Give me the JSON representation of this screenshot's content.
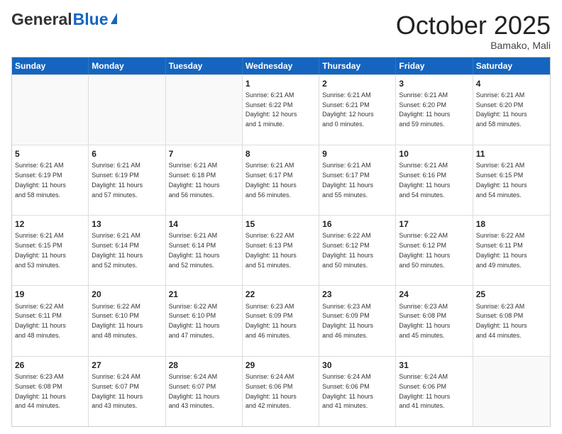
{
  "header": {
    "logo_general": "General",
    "logo_blue": "Blue",
    "month_title": "October 2025",
    "location": "Bamako, Mali"
  },
  "days_of_week": [
    "Sunday",
    "Monday",
    "Tuesday",
    "Wednesday",
    "Thursday",
    "Friday",
    "Saturday"
  ],
  "weeks": [
    [
      {
        "day": "",
        "info": ""
      },
      {
        "day": "",
        "info": ""
      },
      {
        "day": "",
        "info": ""
      },
      {
        "day": "1",
        "info": "Sunrise: 6:21 AM\nSunset: 6:22 PM\nDaylight: 12 hours\nand 1 minute."
      },
      {
        "day": "2",
        "info": "Sunrise: 6:21 AM\nSunset: 6:21 PM\nDaylight: 12 hours\nand 0 minutes."
      },
      {
        "day": "3",
        "info": "Sunrise: 6:21 AM\nSunset: 6:20 PM\nDaylight: 11 hours\nand 59 minutes."
      },
      {
        "day": "4",
        "info": "Sunrise: 6:21 AM\nSunset: 6:20 PM\nDaylight: 11 hours\nand 58 minutes."
      }
    ],
    [
      {
        "day": "5",
        "info": "Sunrise: 6:21 AM\nSunset: 6:19 PM\nDaylight: 11 hours\nand 58 minutes."
      },
      {
        "day": "6",
        "info": "Sunrise: 6:21 AM\nSunset: 6:19 PM\nDaylight: 11 hours\nand 57 minutes."
      },
      {
        "day": "7",
        "info": "Sunrise: 6:21 AM\nSunset: 6:18 PM\nDaylight: 11 hours\nand 56 minutes."
      },
      {
        "day": "8",
        "info": "Sunrise: 6:21 AM\nSunset: 6:17 PM\nDaylight: 11 hours\nand 56 minutes."
      },
      {
        "day": "9",
        "info": "Sunrise: 6:21 AM\nSunset: 6:17 PM\nDaylight: 11 hours\nand 55 minutes."
      },
      {
        "day": "10",
        "info": "Sunrise: 6:21 AM\nSunset: 6:16 PM\nDaylight: 11 hours\nand 54 minutes."
      },
      {
        "day": "11",
        "info": "Sunrise: 6:21 AM\nSunset: 6:15 PM\nDaylight: 11 hours\nand 54 minutes."
      }
    ],
    [
      {
        "day": "12",
        "info": "Sunrise: 6:21 AM\nSunset: 6:15 PM\nDaylight: 11 hours\nand 53 minutes."
      },
      {
        "day": "13",
        "info": "Sunrise: 6:21 AM\nSunset: 6:14 PM\nDaylight: 11 hours\nand 52 minutes."
      },
      {
        "day": "14",
        "info": "Sunrise: 6:21 AM\nSunset: 6:14 PM\nDaylight: 11 hours\nand 52 minutes."
      },
      {
        "day": "15",
        "info": "Sunrise: 6:22 AM\nSunset: 6:13 PM\nDaylight: 11 hours\nand 51 minutes."
      },
      {
        "day": "16",
        "info": "Sunrise: 6:22 AM\nSunset: 6:12 PM\nDaylight: 11 hours\nand 50 minutes."
      },
      {
        "day": "17",
        "info": "Sunrise: 6:22 AM\nSunset: 6:12 PM\nDaylight: 11 hours\nand 50 minutes."
      },
      {
        "day": "18",
        "info": "Sunrise: 6:22 AM\nSunset: 6:11 PM\nDaylight: 11 hours\nand 49 minutes."
      }
    ],
    [
      {
        "day": "19",
        "info": "Sunrise: 6:22 AM\nSunset: 6:11 PM\nDaylight: 11 hours\nand 48 minutes."
      },
      {
        "day": "20",
        "info": "Sunrise: 6:22 AM\nSunset: 6:10 PM\nDaylight: 11 hours\nand 48 minutes."
      },
      {
        "day": "21",
        "info": "Sunrise: 6:22 AM\nSunset: 6:10 PM\nDaylight: 11 hours\nand 47 minutes."
      },
      {
        "day": "22",
        "info": "Sunrise: 6:23 AM\nSunset: 6:09 PM\nDaylight: 11 hours\nand 46 minutes."
      },
      {
        "day": "23",
        "info": "Sunrise: 6:23 AM\nSunset: 6:09 PM\nDaylight: 11 hours\nand 46 minutes."
      },
      {
        "day": "24",
        "info": "Sunrise: 6:23 AM\nSunset: 6:08 PM\nDaylight: 11 hours\nand 45 minutes."
      },
      {
        "day": "25",
        "info": "Sunrise: 6:23 AM\nSunset: 6:08 PM\nDaylight: 11 hours\nand 44 minutes."
      }
    ],
    [
      {
        "day": "26",
        "info": "Sunrise: 6:23 AM\nSunset: 6:08 PM\nDaylight: 11 hours\nand 44 minutes."
      },
      {
        "day": "27",
        "info": "Sunrise: 6:24 AM\nSunset: 6:07 PM\nDaylight: 11 hours\nand 43 minutes."
      },
      {
        "day": "28",
        "info": "Sunrise: 6:24 AM\nSunset: 6:07 PM\nDaylight: 11 hours\nand 43 minutes."
      },
      {
        "day": "29",
        "info": "Sunrise: 6:24 AM\nSunset: 6:06 PM\nDaylight: 11 hours\nand 42 minutes."
      },
      {
        "day": "30",
        "info": "Sunrise: 6:24 AM\nSunset: 6:06 PM\nDaylight: 11 hours\nand 41 minutes."
      },
      {
        "day": "31",
        "info": "Sunrise: 6:24 AM\nSunset: 6:06 PM\nDaylight: 11 hours\nand 41 minutes."
      },
      {
        "day": "",
        "info": ""
      }
    ]
  ]
}
